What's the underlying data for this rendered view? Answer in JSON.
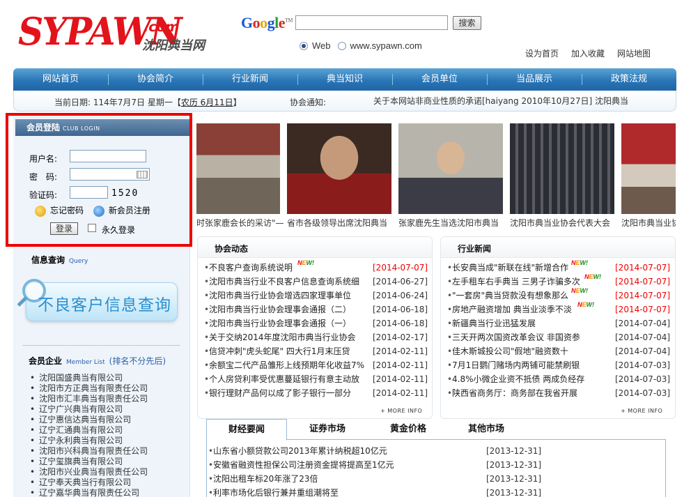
{
  "header": {
    "logo_main": "SYPAWN",
    "logo_com": ".com",
    "logo_cn": "沈阳典当网",
    "google_letters": [
      "G",
      "o",
      "o",
      "g",
      "l",
      "e"
    ],
    "google_tm": "TM",
    "search_button": "搜索",
    "radio_web": "Web",
    "radio_site": "www.sypawn.com",
    "links": [
      "设为首页",
      "加入收藏",
      "网站地图"
    ]
  },
  "nav": [
    "网站首页",
    "协会简介",
    "行业新闻",
    "典当知识",
    "会员单位",
    "当品展示",
    "政策法规"
  ],
  "datebar": {
    "date_prefix": "当前日期: 114年7月7日 星期一【",
    "lunar": "农历 6月11日",
    "date_suffix": "】",
    "notice_label": "协会通知:",
    "notice": "关于本网站非商业性质的承诺[haiyang  2010年10月27日]  沈阳典当"
  },
  "login": {
    "title": "会员登陆",
    "title_en": "CLUB LOGIN",
    "username_label": "用户名:",
    "password_label": "密　码:",
    "captcha_label": "验证码:",
    "captcha_code": "1520",
    "forgot": "忘记密码",
    "register": "新会员注册",
    "submit": "登录",
    "remember": "永久登录"
  },
  "info_query": {
    "title": "信息查询",
    "title_en": "Query",
    "banner": "不良客户信息查询"
  },
  "members": {
    "title": "会员企业",
    "title_en": "Member List",
    "note": "(排名不分先后)",
    "items": [
      "沈阳国盛典当有限公司",
      "沈阳市方正典当有限责任公司",
      "沈阳市汇丰典当有限责任公司",
      "辽宁广兴典当有限公司",
      "辽宁惠信达典当有限公司",
      "辽宁汇通典当有限公司",
      "辽宁永利典当有限公司",
      "沈阳市兴科典当有限责任公司",
      "辽宁玺旗典当有限公司",
      "沈阳市兴业典当有限责任公司",
      "辽宁奉天典当行有限公司",
      "辽宁嘉华典当有限责任公司"
    ]
  },
  "photos": [
    {
      "caption": "时张家鹿会长的采访\"—"
    },
    {
      "caption": "省市各级领导出席沈阳典当"
    },
    {
      "caption": "张家鹿先生当选沈阳市典当"
    },
    {
      "caption": "沈阳市典当业协会代表大会"
    },
    {
      "caption": "沈阳市典当业协"
    }
  ],
  "assoc": {
    "title": "协会动态",
    "more": "MORE INFO",
    "items": [
      {
        "title": "不良客户查询系统说明",
        "new": true,
        "date": "[2014-07-07]",
        "red": true
      },
      {
        "title": "沈阳市典当行业不良客户信息查询系统细",
        "new": false,
        "date": "[2014-06-27]",
        "red": false
      },
      {
        "title": "沈阳市典当行业协会增选四家理事单位",
        "new": false,
        "date": "[2014-06-24]",
        "red": false
      },
      {
        "title": "沈阳市典当行业协会理事会通报（二）",
        "new": false,
        "date": "[2014-06-18]",
        "red": false
      },
      {
        "title": "沈阳市典当行业协会理事会通报（一）",
        "new": false,
        "date": "[2014-06-18]",
        "red": false
      },
      {
        "title": "关于交纳2014年度沈阳市典当行业协会",
        "new": false,
        "date": "[2014-02-17]",
        "red": false
      },
      {
        "title": "信贷冲刺\"虎头蛇尾\" 四大行1月末压贷",
        "new": false,
        "date": "[2014-02-11]",
        "red": false
      },
      {
        "title": "余额宝二代产品雏形上线预期年化收益7%",
        "new": false,
        "date": "[2014-02-11]",
        "red": false
      },
      {
        "title": "个人房贷利率受优惠蔓延银行有意主动放",
        "new": false,
        "date": "[2014-02-11]",
        "red": false
      },
      {
        "title": "银行理财产品何以成了影子银行一部分",
        "new": false,
        "date": "[2014-02-11]",
        "red": false
      }
    ]
  },
  "industry": {
    "title": "行业新闻",
    "more": "MORE INFO",
    "items": [
      {
        "title": "长安典当成\"新联在线\"新增合作",
        "new": true,
        "date": "[2014-07-07]",
        "red": true
      },
      {
        "title": "左手租车右手典当 三男子诈骗多次",
        "new": true,
        "date": "[2014-07-07]",
        "red": true
      },
      {
        "title": "\"一套房\"典当贷款没有想象那么",
        "new": true,
        "date": "[2014-07-07]",
        "red": true
      },
      {
        "title": "房地产融资增加 典当业淡季不淡",
        "new": true,
        "date": "[2014-07-07]",
        "red": true
      },
      {
        "title": "新疆典当行业迅猛发展",
        "new": false,
        "date": "[2014-07-04]",
        "red": false
      },
      {
        "title": "三天开两次国资改革会议 非国资参",
        "new": false,
        "date": "[2014-07-04]",
        "red": false
      },
      {
        "title": "佳木斯城投公司\"假地\"融资数十",
        "new": false,
        "date": "[2014-07-04]",
        "red": false
      },
      {
        "title": "7月1日鹦门赌场内两铺可能禁刷银",
        "new": false,
        "date": "[2014-07-03]",
        "red": false
      },
      {
        "title": "4.8%小微企业资不抵债 两成负经存",
        "new": false,
        "date": "[2014-07-03]",
        "red": false
      },
      {
        "title": "陕西省商务厅：商务部在我省开展",
        "new": false,
        "date": "[2014-07-03]",
        "red": false
      }
    ]
  },
  "new_tag": [
    "N",
    "E",
    "W!"
  ],
  "tabs": [
    "财经要闻",
    "证券市场",
    "黄金价格",
    "其他市场"
  ],
  "finance": [
    {
      "title": "山东省小额贷款公司2013年累计纳税超10亿元",
      "date": "[2013-12-31]"
    },
    {
      "title": "安徽省融资性担保公司注册资金提将提高至1亿元",
      "date": "[2013-12-31]"
    },
    {
      "title": "沈阳出租车标20年涨了23倍",
      "date": "[2013-12-31]"
    },
    {
      "title": "利率市场化后银行兼并重组潮将至",
      "date": "[2013-12-31]"
    }
  ]
}
